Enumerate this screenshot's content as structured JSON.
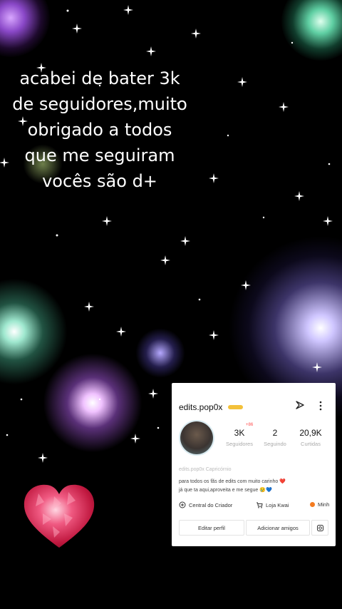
{
  "caption": {
    "lines": [
      "acabei de bater 3k",
      "de seguidores,muito",
      "obrigado a todos",
      "que me seguiram",
      "vocês são d+"
    ]
  },
  "profile_card": {
    "username": "edits.pop0x",
    "badge_new": "+86",
    "stats": [
      {
        "value": "3K",
        "label": "Seguidores"
      },
      {
        "value": "2",
        "label": "Seguindo"
      },
      {
        "value": "20,9K",
        "label": "Curtidas"
      }
    ],
    "meta_line": "edits.pop0x   Capricórnio",
    "bio_line1": "para todos os fãs de edits com muito carinho ❤️",
    "bio_line2": "já que ta aqui,aproveita e me segue 😢💙",
    "links": {
      "creator": "Central do Criador",
      "store": "Loja Kwai",
      "more": "Minh"
    },
    "buttons": {
      "edit_profile": "Editar perfil",
      "add_friends": "Adicionar amigos"
    }
  },
  "colors": {
    "background": "#000000",
    "caption_text": "#ffffff",
    "verified_badge": "#f3c13a",
    "heart": "#e0335a"
  }
}
